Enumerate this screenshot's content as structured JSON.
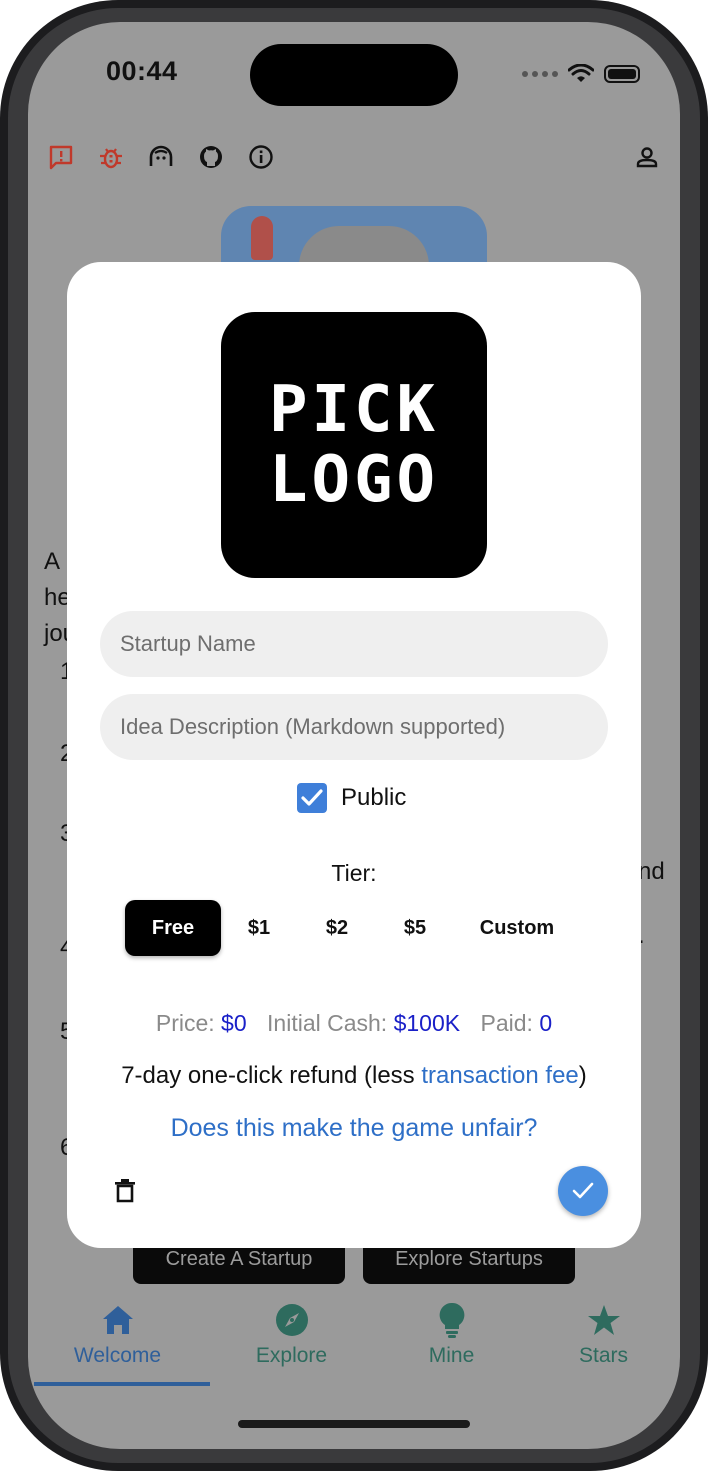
{
  "status_bar": {
    "time": "00:44"
  },
  "toolbar": {
    "icons": [
      "feedback-icon",
      "bug-icon",
      "support-icon",
      "github-icon",
      "info-icon",
      "account-icon"
    ]
  },
  "background": {
    "text_lines": [
      "A",
      "he",
      "jou"
    ],
    "list_numbers": [
      "1",
      "2",
      "3",
      "4",
      "5",
      "6"
    ],
    "right_fragments": [
      "nd",
      "."
    ],
    "buttons": {
      "create": "Create A Startup",
      "explore": "Explore Startups"
    }
  },
  "nav": {
    "items": [
      {
        "label": "Welcome",
        "icon": "home-icon",
        "active": true
      },
      {
        "label": "Explore",
        "icon": "compass-icon",
        "active": false
      },
      {
        "label": "Mine",
        "icon": "lightbulb-icon",
        "active": false
      },
      {
        "label": "Stars",
        "icon": "star-icon",
        "active": false
      }
    ]
  },
  "dialog": {
    "logo": {
      "line1": "PICK",
      "line2": "LOGO"
    },
    "name_placeholder": "Startup Name",
    "description_placeholder": "Idea Description (Markdown supported)",
    "public_label": "Public",
    "public_checked": true,
    "tier_label": "Tier:",
    "tiers": [
      "Free",
      "$1",
      "$2",
      "$5",
      "Custom"
    ],
    "selected_tier": "Free",
    "price": {
      "price_key": "Price:",
      "price_value": "$0",
      "cash_key": "Initial Cash:",
      "cash_value": "$100K",
      "paid_key": "Paid:",
      "paid_value": "0"
    },
    "refund": {
      "prefix": "7-day one-click refund (less ",
      "link": "transaction fee",
      "suffix": ")"
    },
    "unfair_link": "Does this make the game unfair?"
  },
  "colors": {
    "accent": "#4a8fe0",
    "link": "#2e6fc7",
    "value": "#1a20c8",
    "nav_active": "#2f5f9a",
    "nav_inactive": "#2e6b5e",
    "toolbar_warn": "#c0392b"
  }
}
